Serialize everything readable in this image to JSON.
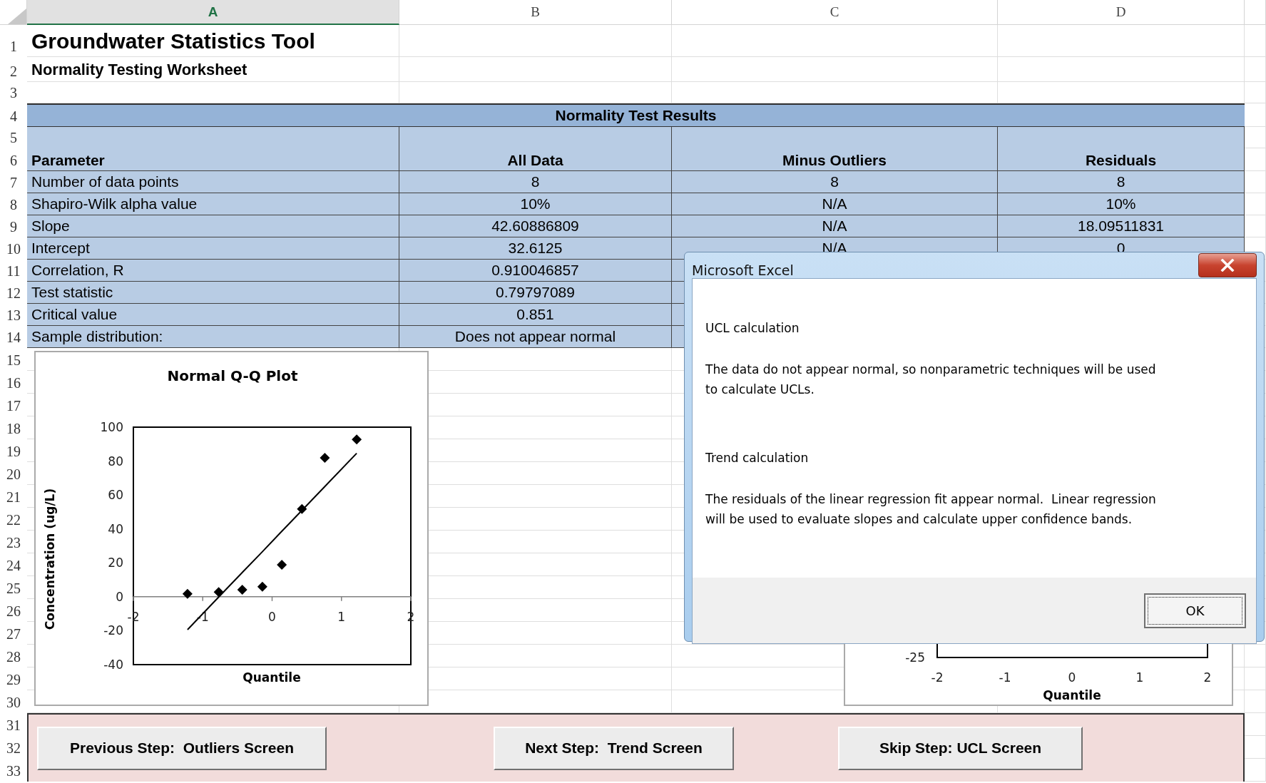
{
  "sheet": {
    "column_headers": [
      {
        "label": "A",
        "selected": true
      },
      {
        "label": "B",
        "selected": false
      },
      {
        "label": "C",
        "selected": false
      },
      {
        "label": "D",
        "selected": false
      }
    ],
    "row_numbers": [
      "1",
      "2",
      "3",
      "4",
      "5",
      "6",
      "7",
      "8",
      "9",
      "10",
      "11",
      "12",
      "13",
      "14",
      "15",
      "16",
      "17",
      "18",
      "19",
      "20",
      "21",
      "22",
      "23",
      "24",
      "25",
      "26",
      "27",
      "28",
      "29",
      "30",
      "31",
      "32",
      "33"
    ],
    "title": "Groundwater Statistics Tool",
    "subtitle": "Normality Testing Worksheet",
    "results": {
      "heading": "Normality Test Results",
      "columns": [
        "Parameter",
        "All Data",
        "Minus Outliers",
        "Residuals"
      ],
      "rows": [
        {
          "cells": [
            "Number of data points",
            "8",
            "8",
            "8"
          ]
        },
        {
          "cells": [
            "Shapiro-Wilk alpha value",
            "10%",
            "N/A",
            "10%"
          ]
        },
        {
          "cells": [
            "Slope",
            "42.60886809",
            "N/A",
            "18.09511831"
          ]
        },
        {
          "cells": [
            "Intercept",
            "32.6125",
            "N/A",
            "0"
          ]
        },
        {
          "cells": [
            "Correlation, R",
            "0.910046857"
          ]
        },
        {
          "cells": [
            "Test statistic",
            "0.79797089"
          ]
        },
        {
          "cells": [
            "Critical value",
            "0.851"
          ]
        },
        {
          "cells": [
            "Sample distribution:",
            "Does not appear normal"
          ]
        }
      ]
    }
  },
  "qq_chart": {
    "chart_data": {
      "type": "scatter",
      "title": "Normal Q-Q Plot",
      "xlabel": "Quantile",
      "ylabel": "Concentration (ug/L)",
      "x": [
        -1.22,
        -0.77,
        -0.43,
        -0.14,
        0.14,
        0.43,
        0.76,
        1.22
      ],
      "series": [
        {
          "type": "scatter",
          "color": "#000000",
          "values": [
            1.7,
            2.8,
            4.1,
            5.9,
            18.9,
            51.8,
            81.9,
            92.8
          ]
        },
        {
          "type": "line",
          "color": "#000000",
          "values": [
            -19.4,
            -0.2,
            14.3,
            26.6,
            38.6,
            50.9,
            65.0,
            84.6
          ]
        }
      ],
      "xlim": [
        -2,
        2
      ],
      "ylim": [
        -40,
        100
      ],
      "xticks": [
        -2,
        -1,
        0,
        1,
        2
      ],
      "yticks": [
        -40,
        -20,
        0,
        20,
        40,
        60,
        80,
        100
      ]
    }
  },
  "residual_chart": {
    "ytick": "-25",
    "xticks": [
      "-2",
      "-1",
      "0",
      "1",
      "2"
    ],
    "xlabel": "Quantile"
  },
  "buttons": [
    "Previous Step:  Outliers Screen",
    "Next Step:  Trend Screen",
    "Skip Step: UCL Screen"
  ],
  "dialog": {
    "title": "Microsoft Excel",
    "sections": [
      {
        "heading": "UCL calculation",
        "text": "The data do not appear normal, so nonparametric techniques will be used\nto calculate UCLs."
      },
      {
        "heading": "Trend calculation",
        "text": "The residuals of the linear regression fit appear normal.  Linear regression\nwill be used to evaluate slopes and calculate upper confidence bands."
      }
    ],
    "ok_button": "OK"
  }
}
